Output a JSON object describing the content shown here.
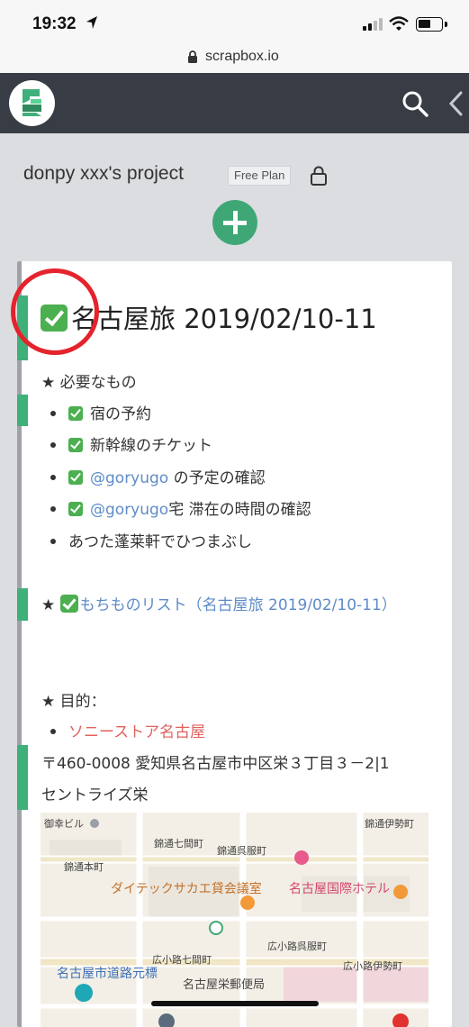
{
  "status_bar": {
    "time": "19:32"
  },
  "browser": {
    "url": "scrapbox.io"
  },
  "header": {
    "project_name": "donpy xxx's project",
    "plan_badge": "Free Plan"
  },
  "page": {
    "title": "名古屋旅 2019/02/10-11",
    "lines": {
      "needs": "★ 必要なもの",
      "item1": "宿の予約",
      "item2": "新幹線のチケット",
      "item3_link": "@goryugo",
      "item3_rest": " の予定の確認",
      "item4_link": "@goryugo",
      "item4_rest": "宅 滞在の時間の確認",
      "item5": "あつた蓬莱軒でひつまぶし",
      "list_star": "★",
      "list_link": "もちものリスト（名古屋旅 2019/02/10-11）",
      "purpose": "★ 目的：",
      "store_link": "ソニーストア名古屋",
      "address1": "〒460-0008 愛知県名古屋市中区栄３丁目３－2|1",
      "address2": "セントライズ栄"
    }
  },
  "map": {
    "labels": {
      "l1": "御幸ビル",
      "l2": "錦通伊勢町",
      "l3": "錦通七間町",
      "l4": "錦通呉服町",
      "l5": "錦通本町",
      "l6": "ダイテックサカエ貸会議室",
      "l7": "名古屋国際ホテル",
      "l8": "広小路七間町",
      "l9": "広小路呉服町",
      "l10": "広小路伊勢町",
      "l11": "名古屋市道路元標",
      "l12": "名古屋栄郵便局"
    }
  },
  "colors": {
    "accent_green": "#3fb07a",
    "nav_dark": "#383d45",
    "link_blue": "#5e8cc7",
    "link_red": "#e0625d",
    "annotation_ring": "#e4232d"
  }
}
